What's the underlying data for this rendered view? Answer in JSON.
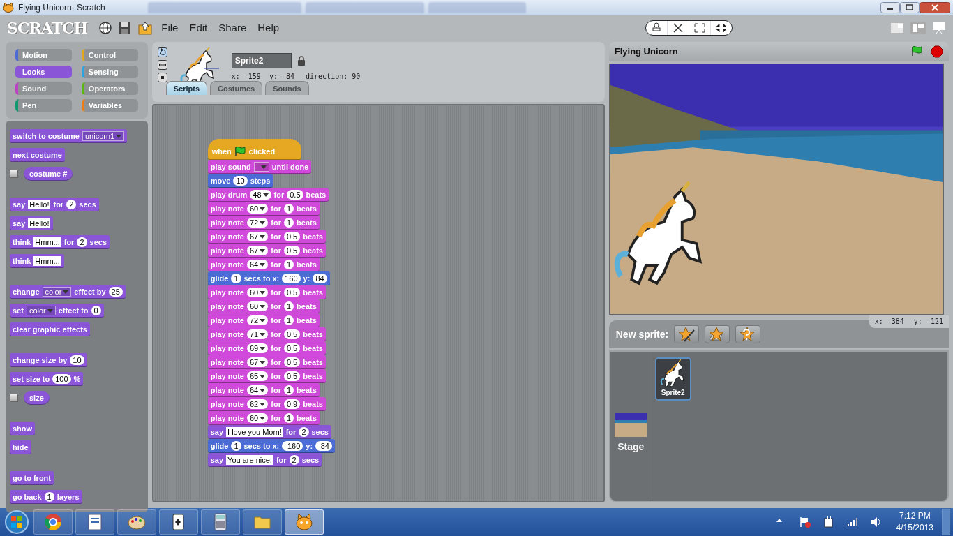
{
  "window": {
    "title": "Flying Unicorn- Scratch"
  },
  "logo": "SCRATCH",
  "menu": [
    "File",
    "Edit",
    "Share",
    "Help"
  ],
  "categories": [
    {
      "label": "Motion",
      "color": "#4a6cd4",
      "selected": false
    },
    {
      "label": "Control",
      "color": "#e1a91a",
      "selected": false
    },
    {
      "label": "Looks",
      "color": "#8a55d7",
      "selected": true
    },
    {
      "label": "Sensing",
      "color": "#2ca5e2",
      "selected": false
    },
    {
      "label": "Sound",
      "color": "#bb42c3",
      "selected": false
    },
    {
      "label": "Operators",
      "color": "#5cb712",
      "selected": false
    },
    {
      "label": "Pen",
      "color": "#0e9a6c",
      "selected": false
    },
    {
      "label": "Variables",
      "color": "#ee7d16",
      "selected": false
    }
  ],
  "palette": [
    [
      {
        "kind": "command",
        "color": "#8a55d7",
        "parts": [
          {
            "kind": "label",
            "text": "switch to costume"
          },
          {
            "kind": "menu",
            "text": "unicorn1"
          }
        ]
      },
      {
        "kind": "command",
        "color": "#8a55d7",
        "parts": [
          {
            "kind": "label",
            "text": "next costume"
          }
        ]
      },
      {
        "kind": "reporter",
        "checked": false,
        "color": "#8a55d7",
        "parts": [
          {
            "kind": "label",
            "text": "costume #"
          }
        ]
      }
    ],
    [
      {
        "kind": "command",
        "color": "#8a55d7",
        "parts": [
          {
            "kind": "label",
            "text": "say"
          },
          {
            "kind": "string",
            "text": "Hello!"
          },
          {
            "kind": "label",
            "text": "for"
          },
          {
            "kind": "number",
            "text": "2"
          },
          {
            "kind": "label",
            "text": "secs"
          }
        ]
      },
      {
        "kind": "command",
        "color": "#8a55d7",
        "parts": [
          {
            "kind": "label",
            "text": "say"
          },
          {
            "kind": "string",
            "text": "Hello!"
          }
        ]
      },
      {
        "kind": "command",
        "color": "#8a55d7",
        "parts": [
          {
            "kind": "label",
            "text": "think"
          },
          {
            "kind": "string",
            "text": "Hmm..."
          },
          {
            "kind": "label",
            "text": "for"
          },
          {
            "kind": "number",
            "text": "2"
          },
          {
            "kind": "label",
            "text": "secs"
          }
        ]
      },
      {
        "kind": "command",
        "color": "#8a55d7",
        "parts": [
          {
            "kind": "label",
            "text": "think"
          },
          {
            "kind": "string",
            "text": "Hmm..."
          }
        ]
      }
    ],
    [
      {
        "kind": "command",
        "color": "#8a55d7",
        "parts": [
          {
            "kind": "label",
            "text": "change"
          },
          {
            "kind": "menu",
            "text": "color"
          },
          {
            "kind": "label",
            "text": "effect by"
          },
          {
            "kind": "number",
            "text": "25"
          }
        ]
      },
      {
        "kind": "command",
        "color": "#8a55d7",
        "parts": [
          {
            "kind": "label",
            "text": "set"
          },
          {
            "kind": "menu",
            "text": "color"
          },
          {
            "kind": "label",
            "text": "effect to"
          },
          {
            "kind": "number",
            "text": "0"
          }
        ]
      },
      {
        "kind": "command",
        "color": "#8a55d7",
        "parts": [
          {
            "kind": "label",
            "text": "clear graphic effects"
          }
        ]
      }
    ],
    [
      {
        "kind": "command",
        "color": "#8a55d7",
        "parts": [
          {
            "kind": "label",
            "text": "change size by"
          },
          {
            "kind": "number",
            "text": "10"
          }
        ]
      },
      {
        "kind": "command",
        "color": "#8a55d7",
        "parts": [
          {
            "kind": "label",
            "text": "set size to"
          },
          {
            "kind": "number",
            "text": "100"
          },
          {
            "kind": "label",
            "text": "%"
          }
        ]
      },
      {
        "kind": "reporter",
        "checked": false,
        "color": "#8a55d7",
        "parts": [
          {
            "kind": "label",
            "text": "size"
          }
        ]
      }
    ],
    [
      {
        "kind": "command",
        "color": "#8a55d7",
        "parts": [
          {
            "kind": "label",
            "text": "show"
          }
        ]
      },
      {
        "kind": "command",
        "color": "#8a55d7",
        "parts": [
          {
            "kind": "label",
            "text": "hide"
          }
        ]
      }
    ],
    [
      {
        "kind": "command",
        "color": "#8a55d7",
        "parts": [
          {
            "kind": "label",
            "text": "go to front"
          }
        ]
      },
      {
        "kind": "command",
        "color": "#8a55d7",
        "parts": [
          {
            "kind": "label",
            "text": "go back"
          },
          {
            "kind": "number",
            "text": "1"
          },
          {
            "kind": "label",
            "text": "layers"
          }
        ]
      }
    ]
  ],
  "sprite": {
    "name": "Sprite2",
    "position": "x: -159  y: -84",
    "direction": "direction: 90",
    "rotation_styles": [
      {
        "selected": true
      },
      {
        "selected": false
      },
      {
        "selected": false
      }
    ]
  },
  "tabs": [
    {
      "label": "Scripts",
      "selected": true
    },
    {
      "label": "Costumes",
      "selected": false
    },
    {
      "label": "Sounds",
      "selected": false
    }
  ],
  "script": [
    {
      "kind": "hat",
      "color": "#e6a822",
      "parts": [
        {
          "kind": "label",
          "text": "when"
        },
        {
          "kind": "flag"
        },
        {
          "kind": "label",
          "text": "clicked"
        }
      ]
    },
    {
      "kind": "command",
      "color": "#cf4ad9",
      "parts": [
        {
          "kind": "label",
          "text": "play sound"
        },
        {
          "kind": "menu"
        },
        {
          "kind": "label",
          "text": "until done"
        }
      ]
    },
    {
      "kind": "command",
      "color": "#4a6cd4",
      "parts": [
        {
          "kind": "label",
          "text": "move"
        },
        {
          "kind": "number",
          "text": "10"
        },
        {
          "kind": "label",
          "text": "steps"
        }
      ]
    },
    {
      "kind": "command",
      "color": "#cf4ad9",
      "parts": [
        {
          "kind": "label",
          "text": "play drum"
        },
        {
          "kind": "number_menu",
          "text": "48"
        },
        {
          "kind": "label",
          "text": "for"
        },
        {
          "kind": "number",
          "text": "0.5"
        },
        {
          "kind": "label",
          "text": "beats"
        }
      ]
    },
    {
      "kind": "command",
      "color": "#cf4ad9",
      "parts": [
        {
          "kind": "label",
          "text": "play note"
        },
        {
          "kind": "number_menu",
          "text": "60"
        },
        {
          "kind": "label",
          "text": "for"
        },
        {
          "kind": "number",
          "text": "1"
        },
        {
          "kind": "label",
          "text": "beats"
        }
      ]
    },
    {
      "kind": "command",
      "color": "#cf4ad9",
      "parts": [
        {
          "kind": "label",
          "text": "play note"
        },
        {
          "kind": "number_menu",
          "text": "72"
        },
        {
          "kind": "label",
          "text": "for"
        },
        {
          "kind": "number",
          "text": "1"
        },
        {
          "kind": "label",
          "text": "beats"
        }
      ]
    },
    {
      "kind": "command",
      "color": "#cf4ad9",
      "parts": [
        {
          "kind": "label",
          "text": "play note"
        },
        {
          "kind": "number_menu",
          "text": "67"
        },
        {
          "kind": "label",
          "text": "for"
        },
        {
          "kind": "number",
          "text": "0.5"
        },
        {
          "kind": "label",
          "text": "beats"
        }
      ]
    },
    {
      "kind": "command",
      "color": "#cf4ad9",
      "parts": [
        {
          "kind": "label",
          "text": "play note"
        },
        {
          "kind": "number_menu",
          "text": "67"
        },
        {
          "kind": "label",
          "text": "for"
        },
        {
          "kind": "number",
          "text": "0.5"
        },
        {
          "kind": "label",
          "text": "beats"
        }
      ]
    },
    {
      "kind": "command",
      "color": "#cf4ad9",
      "parts": [
        {
          "kind": "label",
          "text": "play note"
        },
        {
          "kind": "number_menu",
          "text": "64"
        },
        {
          "kind": "label",
          "text": "for"
        },
        {
          "kind": "number",
          "text": "1"
        },
        {
          "kind": "label",
          "text": "beats"
        }
      ]
    },
    {
      "kind": "command",
      "color": "#4a6cd4",
      "parts": [
        {
          "kind": "label",
          "text": "glide"
        },
        {
          "kind": "number",
          "text": "1"
        },
        {
          "kind": "label",
          "text": "secs to x:"
        },
        {
          "kind": "number",
          "text": "160"
        },
        {
          "kind": "label",
          "text": "y:"
        },
        {
          "kind": "number",
          "text": "84"
        }
      ]
    },
    {
      "kind": "command",
      "color": "#cf4ad9",
      "parts": [
        {
          "kind": "label",
          "text": "play note"
        },
        {
          "kind": "number_menu",
          "text": "60"
        },
        {
          "kind": "label",
          "text": "for"
        },
        {
          "kind": "number",
          "text": "0.5"
        },
        {
          "kind": "label",
          "text": "beats"
        }
      ]
    },
    {
      "kind": "command",
      "color": "#cf4ad9",
      "parts": [
        {
          "kind": "label",
          "text": "play note"
        },
        {
          "kind": "number_menu",
          "text": "60"
        },
        {
          "kind": "label",
          "text": "for"
        },
        {
          "kind": "number",
          "text": "1"
        },
        {
          "kind": "label",
          "text": "beats"
        }
      ]
    },
    {
      "kind": "command",
      "color": "#cf4ad9",
      "parts": [
        {
          "kind": "label",
          "text": "play note"
        },
        {
          "kind": "number_menu",
          "text": "72"
        },
        {
          "kind": "label",
          "text": "for"
        },
        {
          "kind": "number",
          "text": "1"
        },
        {
          "kind": "label",
          "text": "beats"
        }
      ]
    },
    {
      "kind": "command",
      "color": "#cf4ad9",
      "parts": [
        {
          "kind": "label",
          "text": "play note"
        },
        {
          "kind": "number_menu",
          "text": "71"
        },
        {
          "kind": "label",
          "text": "for"
        },
        {
          "kind": "number",
          "text": "0.5"
        },
        {
          "kind": "label",
          "text": "beats"
        }
      ]
    },
    {
      "kind": "command",
      "color": "#cf4ad9",
      "parts": [
        {
          "kind": "label",
          "text": "play note"
        },
        {
          "kind": "number_menu",
          "text": "69"
        },
        {
          "kind": "label",
          "text": "for"
        },
        {
          "kind": "number",
          "text": "0.5"
        },
        {
          "kind": "label",
          "text": "beats"
        }
      ]
    },
    {
      "kind": "command",
      "color": "#cf4ad9",
      "parts": [
        {
          "kind": "label",
          "text": "play note"
        },
        {
          "kind": "number_menu",
          "text": "67"
        },
        {
          "kind": "label",
          "text": "for"
        },
        {
          "kind": "number",
          "text": "0.5"
        },
        {
          "kind": "label",
          "text": "beats"
        }
      ]
    },
    {
      "kind": "command",
      "color": "#cf4ad9",
      "parts": [
        {
          "kind": "label",
          "text": "play note"
        },
        {
          "kind": "number_menu",
          "text": "65"
        },
        {
          "kind": "label",
          "text": "for"
        },
        {
          "kind": "number",
          "text": "0.5"
        },
        {
          "kind": "label",
          "text": "beats"
        }
      ]
    },
    {
      "kind": "command",
      "color": "#cf4ad9",
      "parts": [
        {
          "kind": "label",
          "text": "play note"
        },
        {
          "kind": "number_menu",
          "text": "64"
        },
        {
          "kind": "label",
          "text": "for"
        },
        {
          "kind": "number",
          "text": "1"
        },
        {
          "kind": "label",
          "text": "beats"
        }
      ]
    },
    {
      "kind": "command",
      "color": "#cf4ad9",
      "parts": [
        {
          "kind": "label",
          "text": "play note"
        },
        {
          "kind": "number_menu",
          "text": "62"
        },
        {
          "kind": "label",
          "text": "for"
        },
        {
          "kind": "number",
          "text": "0.9"
        },
        {
          "kind": "label",
          "text": "beats"
        }
      ]
    },
    {
      "kind": "command",
      "color": "#cf4ad9",
      "parts": [
        {
          "kind": "label",
          "text": "play note"
        },
        {
          "kind": "number_menu",
          "text": "60"
        },
        {
          "kind": "label",
          "text": "for"
        },
        {
          "kind": "number",
          "text": "1"
        },
        {
          "kind": "label",
          "text": "beats"
        }
      ]
    },
    {
      "kind": "command",
      "color": "#8a55d7",
      "parts": [
        {
          "kind": "label",
          "text": "say"
        },
        {
          "kind": "string",
          "text": "I love you Mom!"
        },
        {
          "kind": "label",
          "text": "for"
        },
        {
          "kind": "number",
          "text": "2"
        },
        {
          "kind": "label",
          "text": "secs"
        }
      ]
    },
    {
      "kind": "command",
      "color": "#4a6cd4",
      "parts": [
        {
          "kind": "label",
          "text": "glide"
        },
        {
          "kind": "number",
          "text": "1"
        },
        {
          "kind": "label",
          "text": "secs to x:"
        },
        {
          "kind": "number",
          "text": "-160"
        },
        {
          "kind": "label",
          "text": "y:"
        },
        {
          "kind": "number",
          "text": "-84"
        }
      ]
    },
    {
      "kind": "command",
      "color": "#8a55d7",
      "parts": [
        {
          "kind": "label",
          "text": "say"
        },
        {
          "kind": "string",
          "text": "You are nice."
        },
        {
          "kind": "label",
          "text": "for"
        },
        {
          "kind": "number",
          "text": "2"
        },
        {
          "kind": "label",
          "text": "secs"
        }
      ]
    }
  ],
  "stage": {
    "title": "Flying Unicorn",
    "mouse_x": "x: -384",
    "mouse_y": "y: -121"
  },
  "new_sprite": {
    "label": "New sprite:"
  },
  "sprites": [
    {
      "name": "Sprite2",
      "selected": true
    }
  ],
  "stage_thumb": {
    "label": "Stage"
  },
  "taskbar": {
    "apps": [
      {
        "kind": "chrome",
        "selected": false
      },
      {
        "kind": "wordpad",
        "selected": false
      },
      {
        "kind": "paint",
        "selected": false
      },
      {
        "kind": "cards",
        "selected": false
      },
      {
        "kind": "calculator",
        "selected": false
      },
      {
        "kind": "folder",
        "selected": false
      },
      {
        "kind": "cat",
        "selected": true
      }
    ],
    "time": "7:12 PM",
    "date": "4/15/2013"
  }
}
